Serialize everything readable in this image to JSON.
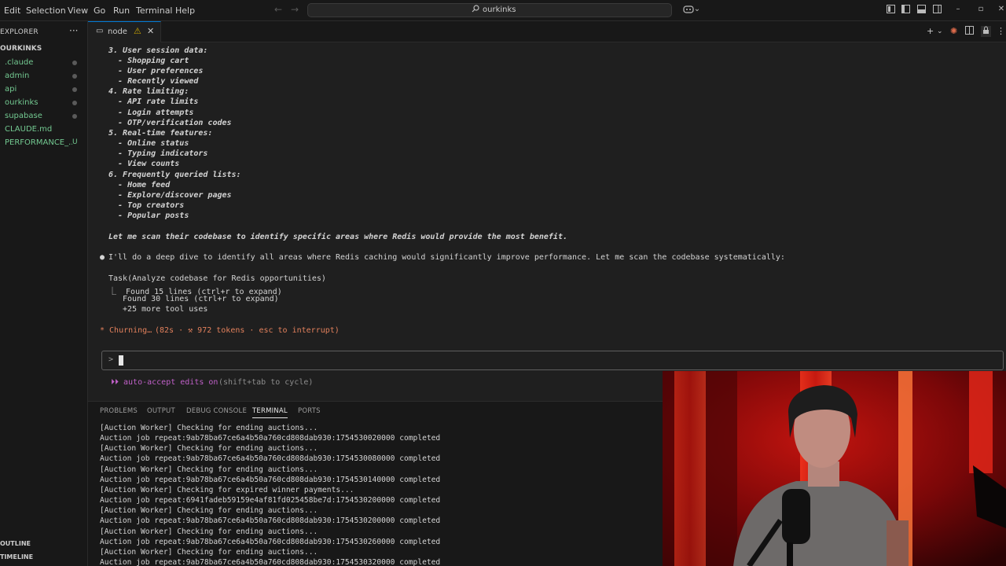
{
  "menu": [
    "Edit",
    "Selection",
    "View",
    "Go",
    "Run",
    "Terminal",
    "Help"
  ],
  "search": {
    "text": "ourkinks"
  },
  "sidebar": {
    "title": "EXPLORER",
    "root": "OURKINKS",
    "items": [
      {
        "label": ".claude"
      },
      {
        "label": "admin"
      },
      {
        "label": "api"
      },
      {
        "label": "ourkinks"
      },
      {
        "label": "supabase"
      },
      {
        "label": "CLAUDE.md"
      },
      {
        "label": "PERFORMANCE_...",
        "badge": "U"
      }
    ],
    "outline": "OUTLINE",
    "timeline": "TIMELINE"
  },
  "tab": {
    "label": "node"
  },
  "editor": {
    "lines": [
      {
        "text": "3. User session data:",
        "style": "it"
      },
      {
        "text": "  - Shopping cart",
        "style": "it"
      },
      {
        "text": "  - User preferences",
        "style": "it"
      },
      {
        "text": "  - Recently viewed",
        "style": "it"
      },
      {
        "text": "4. Rate limiting:",
        "style": "it"
      },
      {
        "text": "  - API rate limits",
        "style": "it"
      },
      {
        "text": "  - Login attempts",
        "style": "it"
      },
      {
        "text": "  - OTP/verification codes",
        "style": "it"
      },
      {
        "text": "5. Real-time features:",
        "style": "it"
      },
      {
        "text": "  - Online status",
        "style": "it"
      },
      {
        "text": "  - Typing indicators",
        "style": "it"
      },
      {
        "text": "  - View counts",
        "style": "it"
      },
      {
        "text": "6. Frequently queried lists:",
        "style": "it"
      },
      {
        "text": "  - Home feed",
        "style": "it"
      },
      {
        "text": "  - Explore/discover pages",
        "style": "it"
      },
      {
        "text": "  - Top creators",
        "style": "it"
      },
      {
        "text": "  - Popular posts",
        "style": "it"
      }
    ],
    "scan_line": "Let me scan their codebase to identify specific areas where Redis would provide the most benefit.",
    "bullet_line": "I'll do a deep dive to identify all areas where Redis caching would significantly improve performance. Let me scan the codebase systematically:",
    "task_line": "Task(Analyze codebase for Redis opportunities)",
    "found1": "⎿  Found 15 lines (ctrl+r to expand)",
    "found2": "Found 30 lines (ctrl+r to expand)",
    "more": "+25 more tool uses",
    "churn_word": "* Churning…",
    "churn_info": "(82s · ⚒ 972 tokens · esc to interrupt)",
    "prompt_chevron": ">",
    "accept_label": "⏵⏵ auto-accept edits on",
    "accept_hint": "(shift+tab to cycle)"
  },
  "panel": {
    "tabs": [
      "PROBLEMS",
      "OUTPUT",
      "DEBUG CONSOLE",
      "TERMINAL",
      "PORTS"
    ],
    "active_tab": "TERMINAL",
    "log": [
      "[Auction Worker] Checking for ending auctions...",
      "Auction job repeat:9ab78ba67ce6a4b50a760cd808dab930:1754530020000 completed",
      "[Auction Worker] Checking for ending auctions...",
      "Auction job repeat:9ab78ba67ce6a4b50a760cd808dab930:1754530080000 completed",
      "[Auction Worker] Checking for ending auctions...",
      "Auction job repeat:9ab78ba67ce6a4b50a760cd808dab930:1754530140000 completed",
      "[Auction Worker] Checking for expired winner payments...",
      "Auction job repeat:6941fadeb59159e4af81fd025458be7d:1754530200000 completed",
      "[Auction Worker] Checking for ending auctions...",
      "Auction job repeat:9ab78ba67ce6a4b50a760cd808dab930:1754530200000 completed",
      "[Auction Worker] Checking for ending auctions...",
      "Auction job repeat:9ab78ba67ce6a4b50a760cd808dab930:1754530260000 completed",
      "[Auction Worker] Checking for ending auctions...",
      "Auction job repeat:9ab78ba67ce6a4b50a760cd808dab930:1754530320000 completed"
    ]
  },
  "icons": {
    "search": "search-icon",
    "copilot": "copilot-icon",
    "warning": "warning-icon",
    "close": "close-icon",
    "add": "add-icon",
    "split": "split-editor-icon"
  }
}
